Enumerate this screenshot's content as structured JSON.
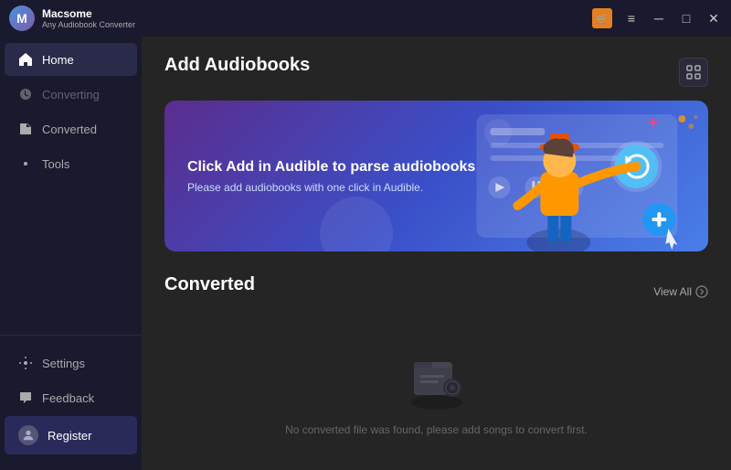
{
  "titleBar": {
    "appName": "Macsome",
    "appSubtitle": "Any Audiobook Converter",
    "cartIconChar": "🛒",
    "menuChar": "≡",
    "minimizeChar": "─",
    "maximizeChar": "□",
    "closeChar": "✕"
  },
  "sidebar": {
    "items": [
      {
        "id": "home",
        "label": "Home",
        "active": true,
        "disabled": false
      },
      {
        "id": "converting",
        "label": "Converting",
        "active": false,
        "disabled": true
      },
      {
        "id": "converted",
        "label": "Converted",
        "active": false,
        "disabled": false
      },
      {
        "id": "tools",
        "label": "Tools",
        "active": false,
        "disabled": false
      }
    ],
    "bottomItems": [
      {
        "id": "settings",
        "label": "Settings"
      },
      {
        "id": "feedback",
        "label": "Feedback"
      }
    ],
    "registerLabel": "Register"
  },
  "content": {
    "addAudiobooks": {
      "title": "Add Audiobooks",
      "bannerHeadline": "Click Add in Audible to parse audiobooks",
      "bannerSub": "Please add audiobooks with one click in Audible.",
      "scanBtnChar": "⊞"
    },
    "converted": {
      "title": "Converted",
      "viewAllLabel": "View All",
      "emptyText": "No converted file was found, please add songs to convert first."
    }
  },
  "colors": {
    "accent": "#4a90e2",
    "sidebar": "#1a1a2e",
    "content": "#252525",
    "active": "#2a2a4a"
  }
}
